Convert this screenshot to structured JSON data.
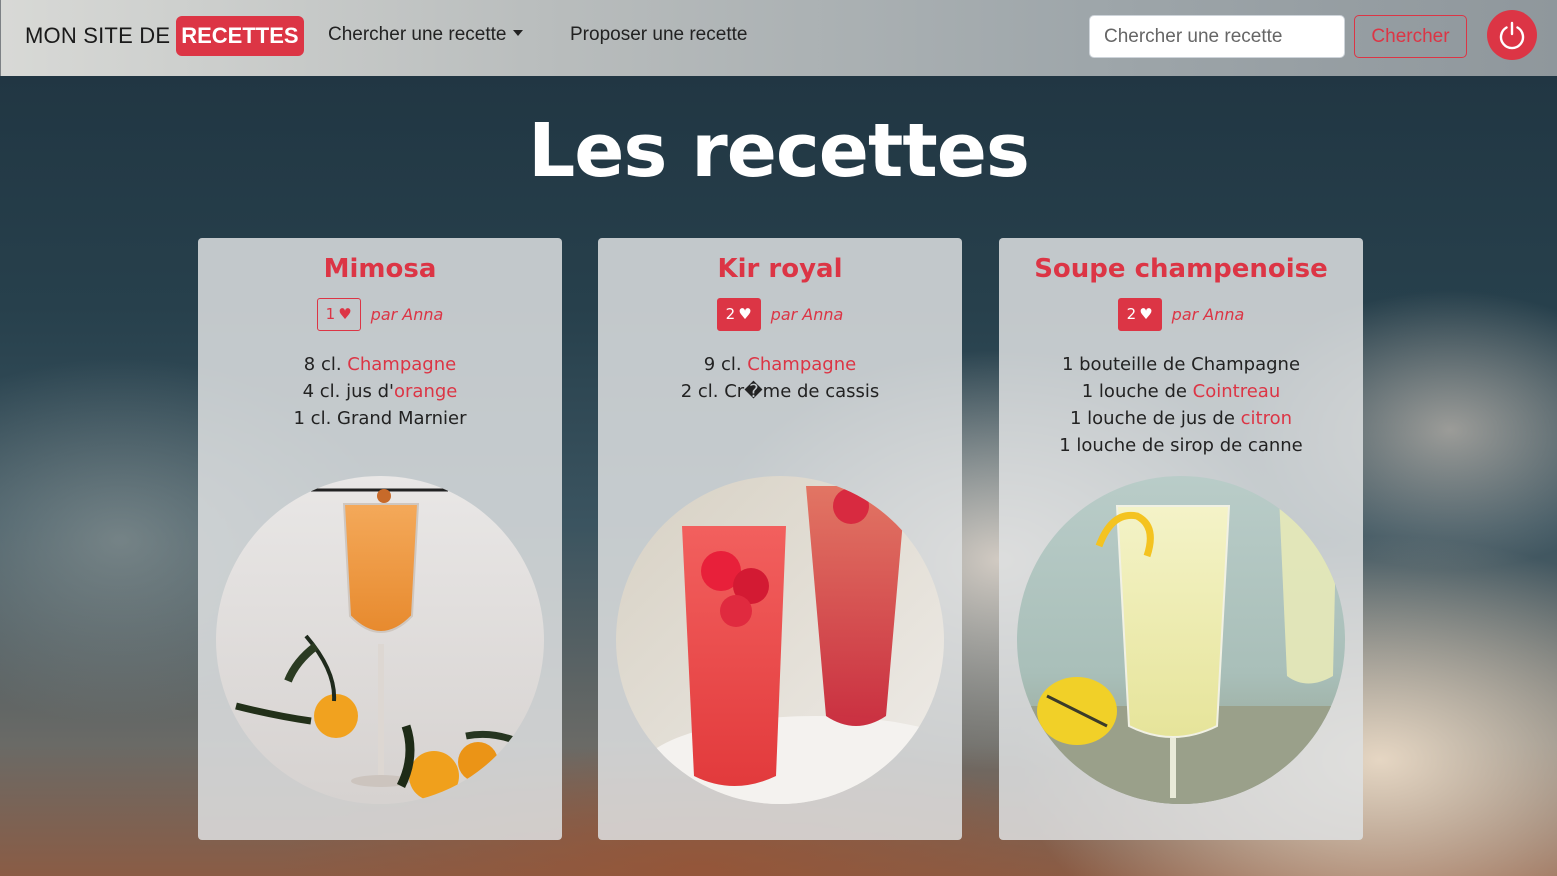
{
  "navbar": {
    "brand_text": "MON SITE DE",
    "brand_badge": "RECETTES",
    "menu_search": "Chercher une recette",
    "menu_propose": "Proposer une recette",
    "search_placeholder": "Chercher une recette",
    "search_button": "Chercher",
    "power_icon": "power-icon"
  },
  "main": {
    "title": "Les recettes"
  },
  "recipes": [
    {
      "title": "Mimosa",
      "likes": "1",
      "liked": false,
      "author": "par Anna",
      "ingredients": [
        {
          "before": "8 cl. ",
          "highlight": "Champagne",
          "after": ""
        },
        {
          "before": "4 cl. jus d'",
          "highlight": "orange",
          "after": ""
        },
        {
          "before": "1 cl. Grand Marnier",
          "highlight": "",
          "after": ""
        }
      ]
    },
    {
      "title": "Kir royal",
      "likes": "2",
      "liked": true,
      "author": "par Anna",
      "ingredients": [
        {
          "before": "9 cl. ",
          "highlight": "Champagne",
          "after": ""
        },
        {
          "before": "2 cl. Cr�me de cassis",
          "highlight": "",
          "after": ""
        }
      ]
    },
    {
      "title": "Soupe champenoise",
      "likes": "2",
      "liked": true,
      "author": "par Anna",
      "ingredients": [
        {
          "before": "1 bouteille de Champagne",
          "highlight": "",
          "after": ""
        },
        {
          "before": "1 louche de ",
          "highlight": "Cointreau",
          "after": ""
        },
        {
          "before": "1 louche de jus de ",
          "highlight": "citron",
          "after": ""
        },
        {
          "before": "1 louche de sirop de canne",
          "highlight": "",
          "after": ""
        }
      ]
    }
  ],
  "heart_glyph": "♥",
  "colors": {
    "accent": "#dc3545",
    "title": "#ffffff"
  }
}
